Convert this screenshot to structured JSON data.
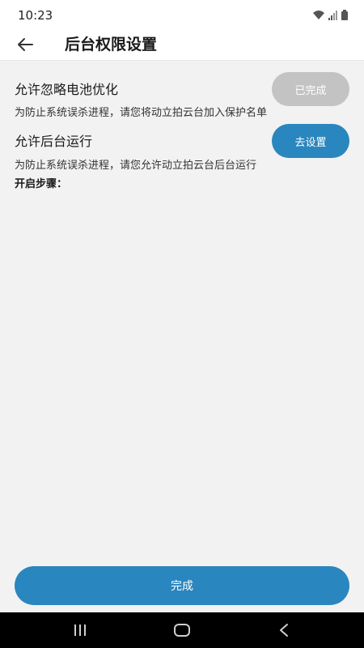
{
  "status_bar": {
    "time": "10:23",
    "icons": [
      "wifi-icon",
      "signal-icon",
      "battery-icon"
    ]
  },
  "app_bar": {
    "back_icon": "arrow-left-icon",
    "title": "后台权限设置"
  },
  "permissions": [
    {
      "title": "允许忽略电池优化",
      "description": "为防止系统误杀进程，请您将动立拍云台加入保护名单",
      "button_label": "已完成",
      "button_state": "completed",
      "button_color": "#c3c3c3"
    },
    {
      "title": "允许后台运行",
      "description": "为防止系统误杀进程，请您允许动立拍云台后台运行",
      "button_label": "去设置",
      "button_state": "pending",
      "button_color": "#2a86be"
    }
  ],
  "steps_label": "开启步骤：",
  "finish_button_label": "完成",
  "colors": {
    "accent": "#2a86be",
    "disabled": "#c3c3c3",
    "background": "#f2f2f2"
  },
  "nav_bar": {
    "icons": [
      "recent-apps-icon",
      "home-icon",
      "back-nav-icon"
    ]
  }
}
